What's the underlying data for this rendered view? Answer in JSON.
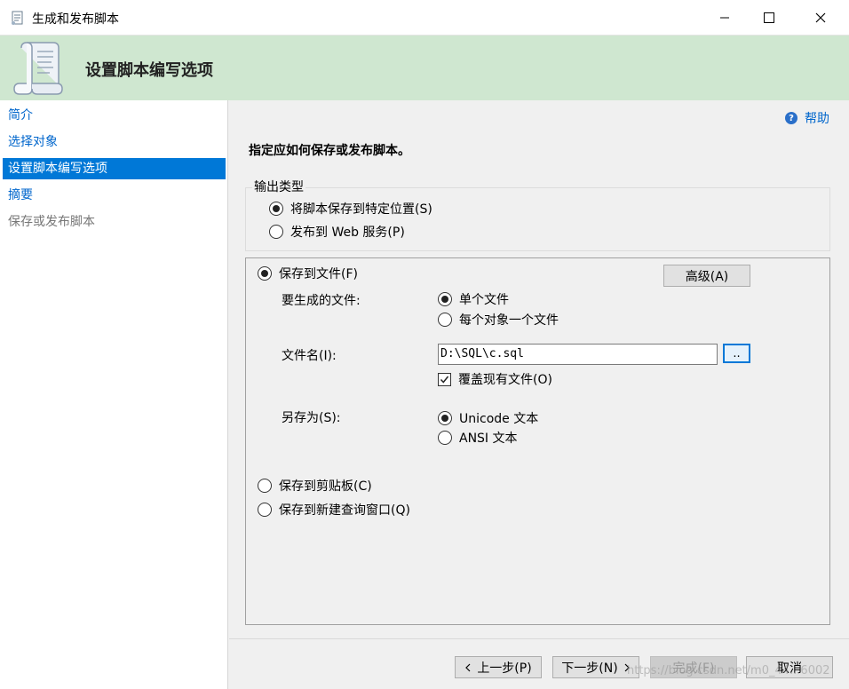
{
  "window": {
    "title": "生成和发布脚本",
    "controls": {
      "minimize_icon": "minimize-icon",
      "maximize_icon": "maximize-icon",
      "close_icon": "close-icon"
    }
  },
  "header": {
    "title": "设置脚本编写选项",
    "background": "#cfe7d0"
  },
  "nav": {
    "items": [
      {
        "label": "简介",
        "state": "link"
      },
      {
        "label": "选择对象",
        "state": "link"
      },
      {
        "label": "设置脚本编写选项",
        "state": "selected"
      },
      {
        "label": "摘要",
        "state": "link"
      },
      {
        "label": "保存或发布脚本",
        "state": "disabled"
      }
    ],
    "selected_color": "#0078d7"
  },
  "help": {
    "label": "帮助"
  },
  "instruction": "指定应如何保存或发布脚本。",
  "output_type": {
    "legend": "输出类型",
    "options": [
      {
        "label": "将脚本保存到特定位置(S)",
        "checked": true
      },
      {
        "label": "发布到 Web 服务(P)",
        "checked": false
      }
    ]
  },
  "save": {
    "to_file": {
      "label": "保存到文件(F)",
      "checked": true
    },
    "advanced_button": "高级(A)",
    "files_to_generate": {
      "label": "要生成的文件:",
      "options": [
        {
          "label": "单个文件",
          "checked": true
        },
        {
          "label": "每个对象一个文件",
          "checked": false
        }
      ]
    },
    "filename": {
      "label": "文件名(I):",
      "value": "D:\\SQL\\c.sql",
      "browse_label": ".."
    },
    "overwrite": {
      "label": "覆盖现有文件(O)",
      "checked": true
    },
    "save_as": {
      "label": "另存为(S):",
      "options": [
        {
          "label": "Unicode 文本",
          "checked": true
        },
        {
          "label": "ANSI 文本",
          "checked": false
        }
      ]
    },
    "to_clipboard": {
      "label": "保存到剪贴板(C)",
      "checked": false
    },
    "to_new_query": {
      "label": "保存到新建查询窗口(Q)",
      "checked": false
    }
  },
  "footer": {
    "prev": "上一步(P)",
    "next": "下一步(N)",
    "finish": "完成(F)",
    "cancel": "取消"
  },
  "watermark": "https://blog.csdn.net/m0_44...6002"
}
